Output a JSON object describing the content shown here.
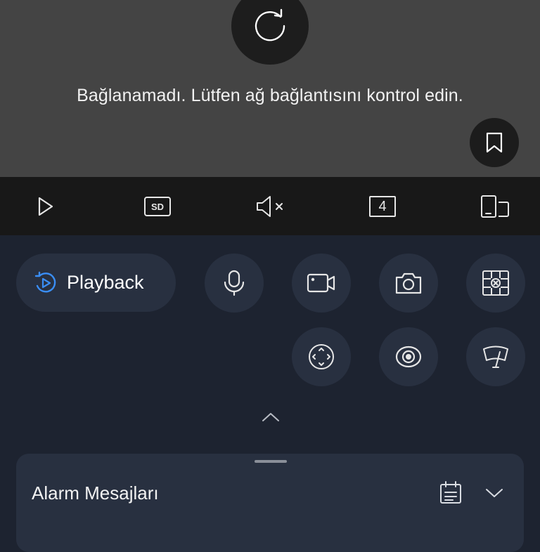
{
  "video": {
    "error_message": "Bağlanamadı. Lütfen ağ bağlantısını kontrol edin.",
    "retry_icon": "refresh-icon",
    "bookmark_icon": "bookmark-icon"
  },
  "toolbar": {
    "play_icon": "play-icon",
    "quality_label": "SD",
    "mute_icon": "speaker-muted-icon",
    "split_label": "4",
    "orientation_icon": "rotate-device-icon"
  },
  "actions": {
    "playback_label": "Playback",
    "playback_icon": "playback-icon",
    "buttons": [
      "microphone-icon",
      "video-record-icon",
      "camera-icon",
      "grid-close-icon",
      "ptz-icon",
      "eye-icon",
      "wiper-icon"
    ]
  },
  "alarm_panel": {
    "title": "Alarm Mesajları",
    "calendar_icon": "calendar-icon",
    "expand_icon": "chevron-down-icon"
  },
  "colors": {
    "background": "#1d2330",
    "button_bg": "#283040",
    "accent": "#3a8ef6",
    "video_bg": "#444444",
    "toolbar_bg": "#181818"
  }
}
